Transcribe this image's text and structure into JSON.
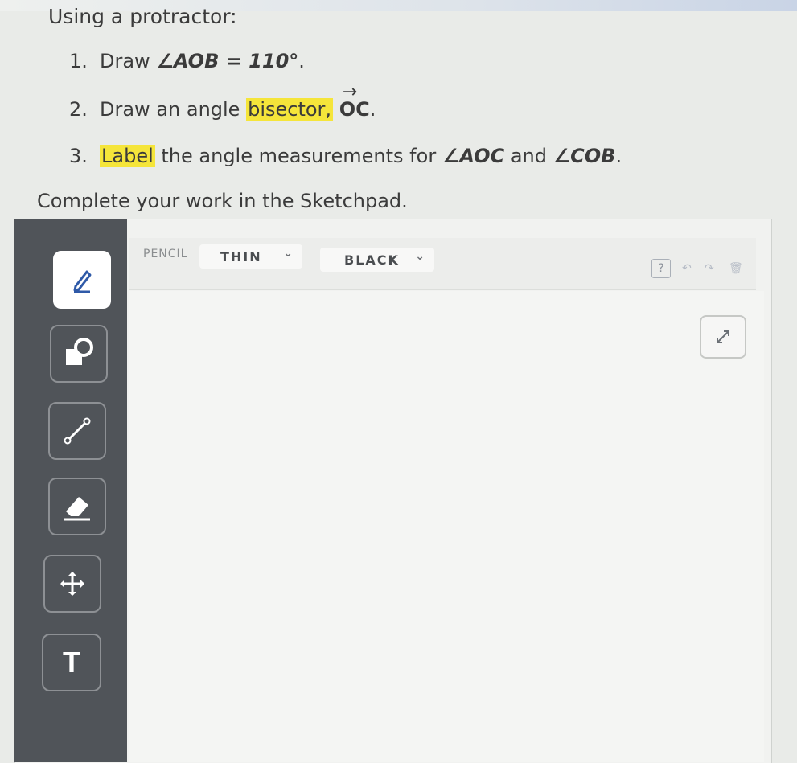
{
  "instructions": {
    "intro": "Using a protractor:",
    "steps": [
      {
        "num": "1.",
        "text": "Draw ",
        "math": "∠AOB = 110°",
        "tail": "."
      },
      {
        "num": "2.",
        "pre": "Draw an angle ",
        "highlight": "bisector,",
        "post": " ",
        "ray": "OC",
        "tail": "."
      },
      {
        "num": "3.",
        "highlight": "Label",
        "post": " the angle measurements for ",
        "m1": "∠AOC",
        "and": " and ",
        "m2": "∠COB",
        "tail": "."
      }
    ],
    "complete": "Complete your work in the Sketchpad."
  },
  "sketchpad": {
    "toolbar": {
      "tool_label": "PENCIL",
      "thickness": "THIN",
      "color": "BLACK"
    },
    "help": "?",
    "tools": [
      "pencil-icon",
      "shapes-icon",
      "line-segment-icon",
      "eraser-icon",
      "move-icon",
      "text-tool-icon"
    ],
    "text_tool_glyph": "T"
  },
  "colors": {
    "highlight": "#f5e53a",
    "sidebar": "#505459",
    "canvas": "#f4f5f3",
    "active_tool": "#ffffff"
  }
}
